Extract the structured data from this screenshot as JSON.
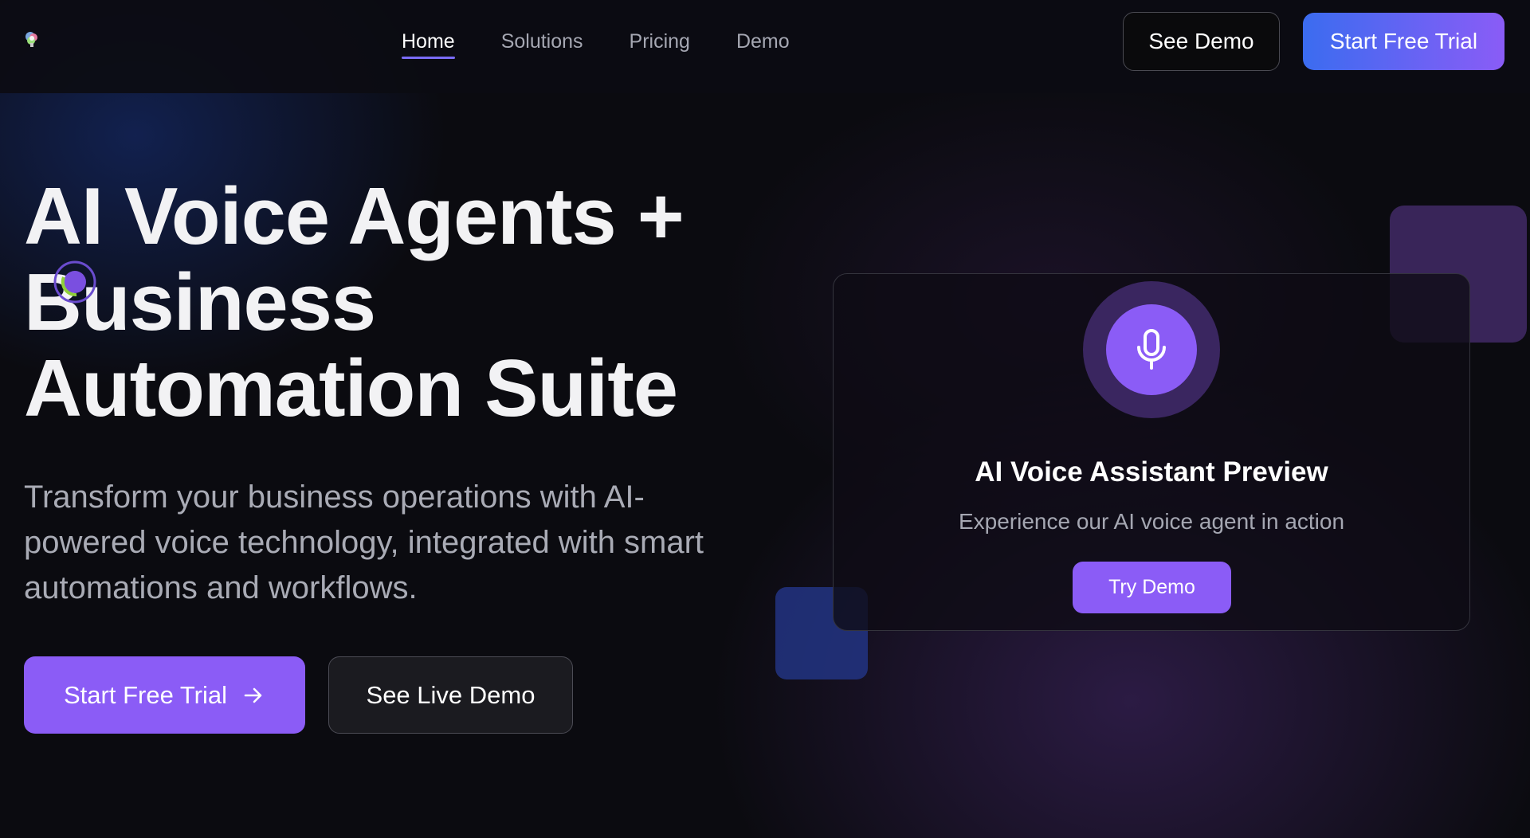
{
  "header": {
    "logo_text": "",
    "nav": [
      {
        "label": "Home",
        "active": true
      },
      {
        "label": "Solutions",
        "active": false
      },
      {
        "label": "Pricing",
        "active": false
      },
      {
        "label": "Demo",
        "active": false
      }
    ],
    "see_demo_label": "See Demo",
    "start_trial_label": "Start Free Trial"
  },
  "hero": {
    "title_lines": [
      "AI Voice Agents +",
      "Business",
      "Automation Suite"
    ],
    "subtitle": "Transform your business operations with AI-powered voice technology, integrated with smart automations and workflows.",
    "primary_cta": "Start Free Trial",
    "secondary_cta": "See Live Demo"
  },
  "preview_card": {
    "icon": "microphone-icon",
    "title": "AI Voice Assistant Preview",
    "subtitle": "Experience our AI voice agent in action",
    "button_label": "Try Demo"
  },
  "colors": {
    "accent": "#8b5cf6",
    "gradient_start": "#3b6cf0",
    "gradient_end": "#8a5cf6",
    "background": "#0b0b10"
  }
}
